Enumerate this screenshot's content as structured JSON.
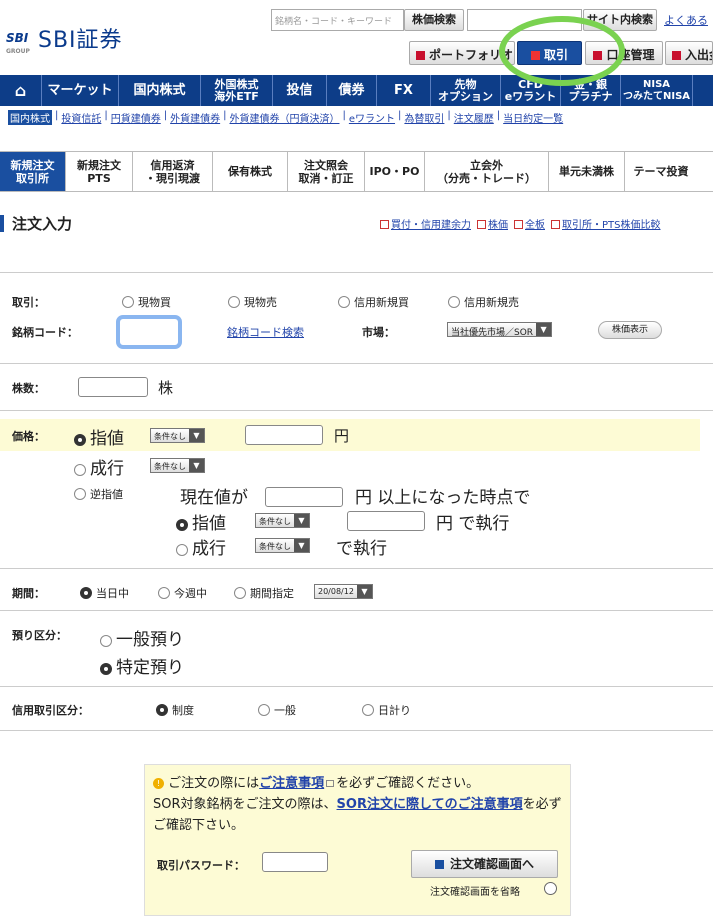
{
  "header": {
    "logo_mark": "SBI",
    "logo_group": "GROUP",
    "logo_text": "SBI証券",
    "search_placeholder": "銘柄名・コード・キーワード",
    "stock_search_btn": "株価検索",
    "site_search_btn": "サイト内検索",
    "help_link": "よくある",
    "portfolio_btn": "ポートフォリオ",
    "trade_btn": "取引",
    "account_btn": "口座管理",
    "deposit_btn": "入出金"
  },
  "nav": [
    {
      "label": "⌂"
    },
    {
      "label": "マーケット"
    },
    {
      "label": "国内株式"
    },
    {
      "label": "外国株式\n海外ETF"
    },
    {
      "label": "投信"
    },
    {
      "label": "債券"
    },
    {
      "label": "FX"
    },
    {
      "label": "先物\nオプション"
    },
    {
      "label": "CFD\neワラント"
    },
    {
      "label": "金・銀\nプラチナ"
    },
    {
      "label": "NISA\nつみたてNISA"
    }
  ],
  "subnav": [
    "国内株式",
    "投資信託",
    "円貨建債券",
    "外貨建債券",
    "外貨建債券（円貨決済）",
    "eワラント",
    "為替取引",
    "注文履歴",
    "当日約定一覧"
  ],
  "tabs": [
    "新規注文\n取引所",
    "新規注文\nPTS",
    "信用返済\n・現引現渡",
    "保有株式",
    "注文照会\n取消・訂正",
    "IPO・PO",
    "立会外\n（分売・トレード）",
    "単元未満株",
    "テーマ投資"
  ],
  "page_title": "注文入力",
  "top_links": [
    "買付・信用建余力",
    "株価",
    "全板",
    "取引所・PTS株価比較"
  ],
  "form": {
    "trade_label": "取引：",
    "trade_options": [
      "現物買",
      "現物売",
      "信用新規買",
      "信用新規売"
    ],
    "code_label": "銘柄コード：",
    "code_search_link": "銘柄コード検索",
    "market_label": "市場：",
    "market_value": "当社優先市場／SOR",
    "quote_btn": "株価表示",
    "qty_label": "株数：",
    "qty_unit": "株",
    "price_label": "価格：",
    "limit_label": "指値",
    "condition_none": "条件なし",
    "yen": "円",
    "market_order_label": "成行",
    "stop_label": "逆指値",
    "stop_text1": "現在値が",
    "stop_text2": "円 以上になった時点で",
    "stop_limit": "指値",
    "stop_exec": "円 で執行",
    "stop_market": "成行",
    "stop_market_exec": "で執行",
    "period_label": "期間：",
    "period_options": [
      "当日中",
      "今週中",
      "期間指定"
    ],
    "period_date": "20/08/12",
    "deposit_label": "預り区分：",
    "deposit_options": [
      "一般預り",
      "特定預り"
    ],
    "credit_label": "信用取引区分：",
    "credit_options": [
      "制度",
      "一般",
      "日計り"
    ]
  },
  "notice": {
    "line1a": "ご注文の際には",
    "line1link": "ご注意事項",
    "line1b": "を必ずご確認ください。",
    "line2a": "SOR対象銘柄をご注文の際は、",
    "line2link": "SOR注文に際してのご注意事項",
    "line2b": "を必ずご確認下さい。",
    "password_label": "取引パスワード：",
    "confirm_btn": "注文確認画面へ",
    "skip_label": "注文確認画面を省略"
  }
}
